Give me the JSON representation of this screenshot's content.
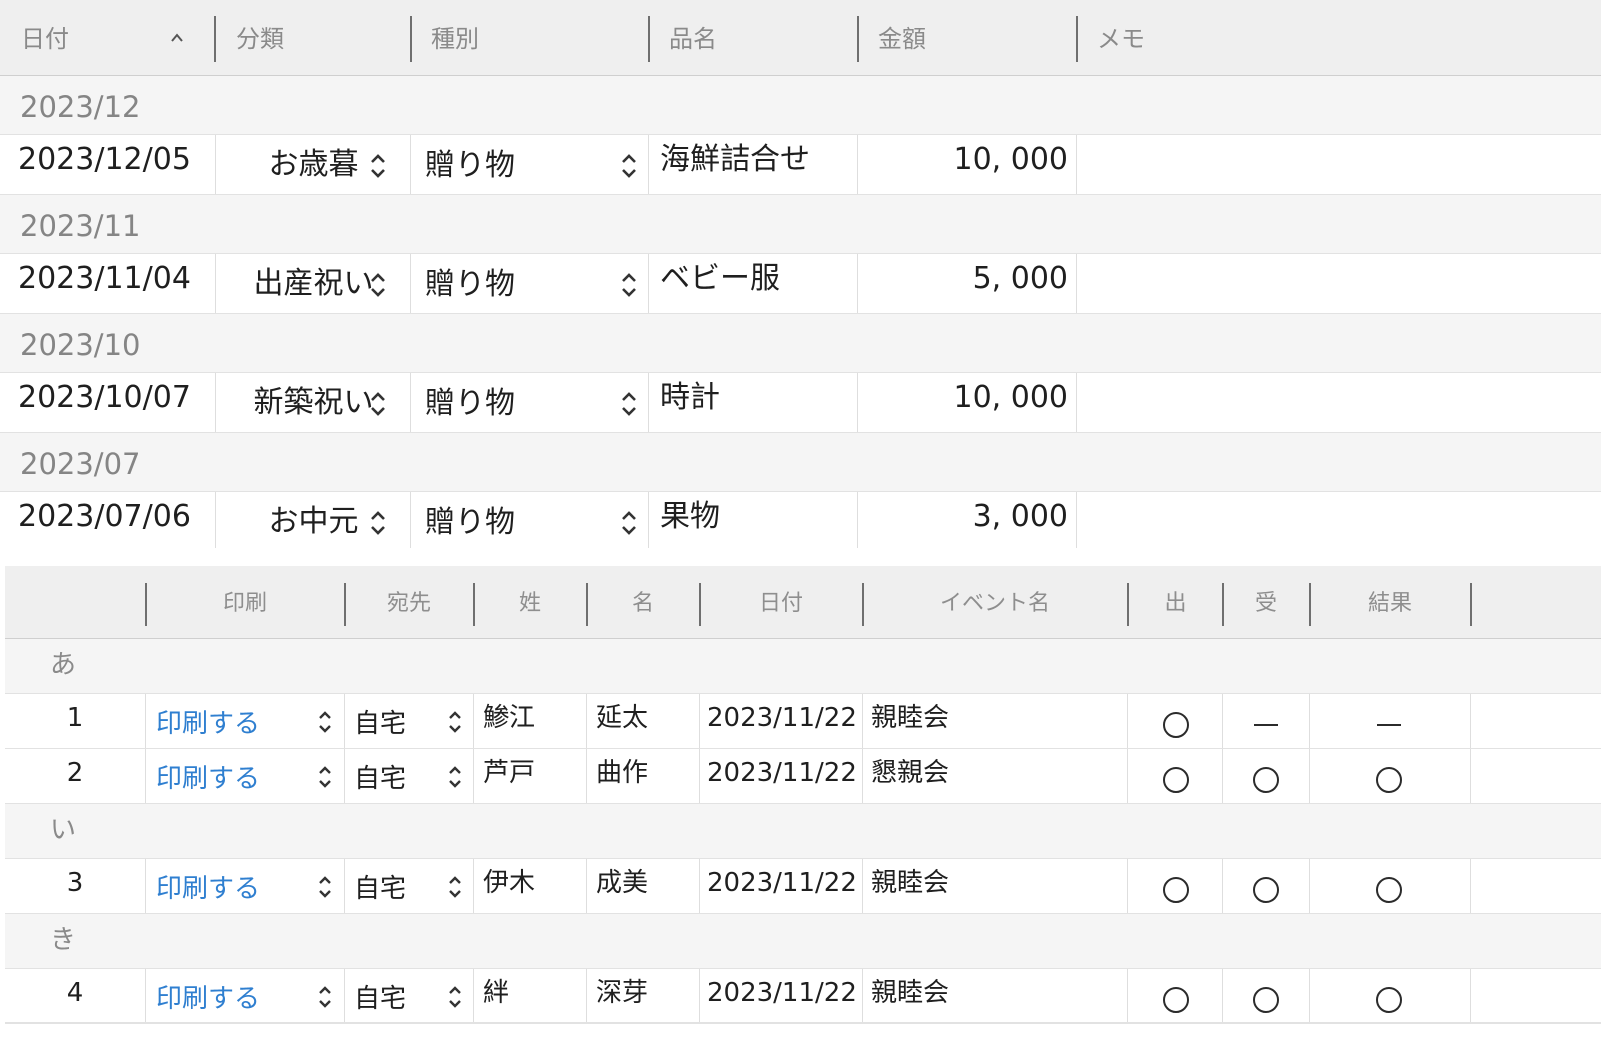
{
  "gift_table": {
    "columns": [
      "日付",
      "分類",
      "種別",
      "品名",
      "金額",
      "メモ"
    ],
    "sort_icon": "chevron-up-icon",
    "groups": [
      {
        "label": "2023/12",
        "rows": [
          {
            "date": "2023/12/05",
            "category": "お歳暮",
            "type": "贈り物",
            "item": "海鮮詰合せ",
            "amount": "10, 000",
            "memo": ""
          }
        ]
      },
      {
        "label": "2023/11",
        "rows": [
          {
            "date": "2023/11/04",
            "category": "出産祝い",
            "type": "贈り物",
            "item": "ベビー服",
            "amount": "5, 000",
            "memo": ""
          }
        ]
      },
      {
        "label": "2023/10",
        "rows": [
          {
            "date": "2023/10/07",
            "category": "新築祝い",
            "type": "贈り物",
            "item": "時計",
            "amount": "10, 000",
            "memo": ""
          }
        ]
      },
      {
        "label": "2023/07",
        "rows": [
          {
            "date": "2023/07/06",
            "category": "お中元",
            "type": "贈り物",
            "item": "果物",
            "amount": "3, 000",
            "memo": ""
          }
        ]
      }
    ]
  },
  "contact_table": {
    "columns": [
      "",
      "印刷",
      "宛先",
      "姓",
      "名",
      "日付",
      "イベント名",
      "出",
      "受",
      "結果"
    ],
    "groups": [
      {
        "label": "あ",
        "rows": [
          {
            "no": "1",
            "print": "印刷する",
            "destination": "自宅",
            "last_name": "鯵江",
            "first_name": "延太",
            "date": "2023/11/22",
            "event": "親睦会",
            "out": "circle",
            "in": "dash",
            "result": "dash"
          },
          {
            "no": "2",
            "print": "印刷する",
            "destination": "自宅",
            "last_name": "芦戸",
            "first_name": "曲作",
            "date": "2023/11/22",
            "event": "懇親会",
            "out": "circle",
            "in": "circle",
            "result": "circle"
          }
        ]
      },
      {
        "label": "い",
        "rows": [
          {
            "no": "3",
            "print": "印刷する",
            "destination": "自宅",
            "last_name": "伊木",
            "first_name": "成美",
            "date": "2023/11/22",
            "event": "親睦会",
            "out": "circle",
            "in": "circle",
            "result": "circle"
          }
        ]
      },
      {
        "label": "き",
        "rows": [
          {
            "no": "4",
            "print": "印刷する",
            "destination": "自宅",
            "last_name": "絆",
            "first_name": "深芽",
            "date": "2023/11/22",
            "event": "親睦会",
            "out": "circle",
            "in": "circle",
            "result": "circle"
          }
        ]
      }
    ]
  },
  "colors": {
    "link": "#2f7fd0",
    "header_bg": "#efefef",
    "group_bg": "#f5f5f5"
  }
}
